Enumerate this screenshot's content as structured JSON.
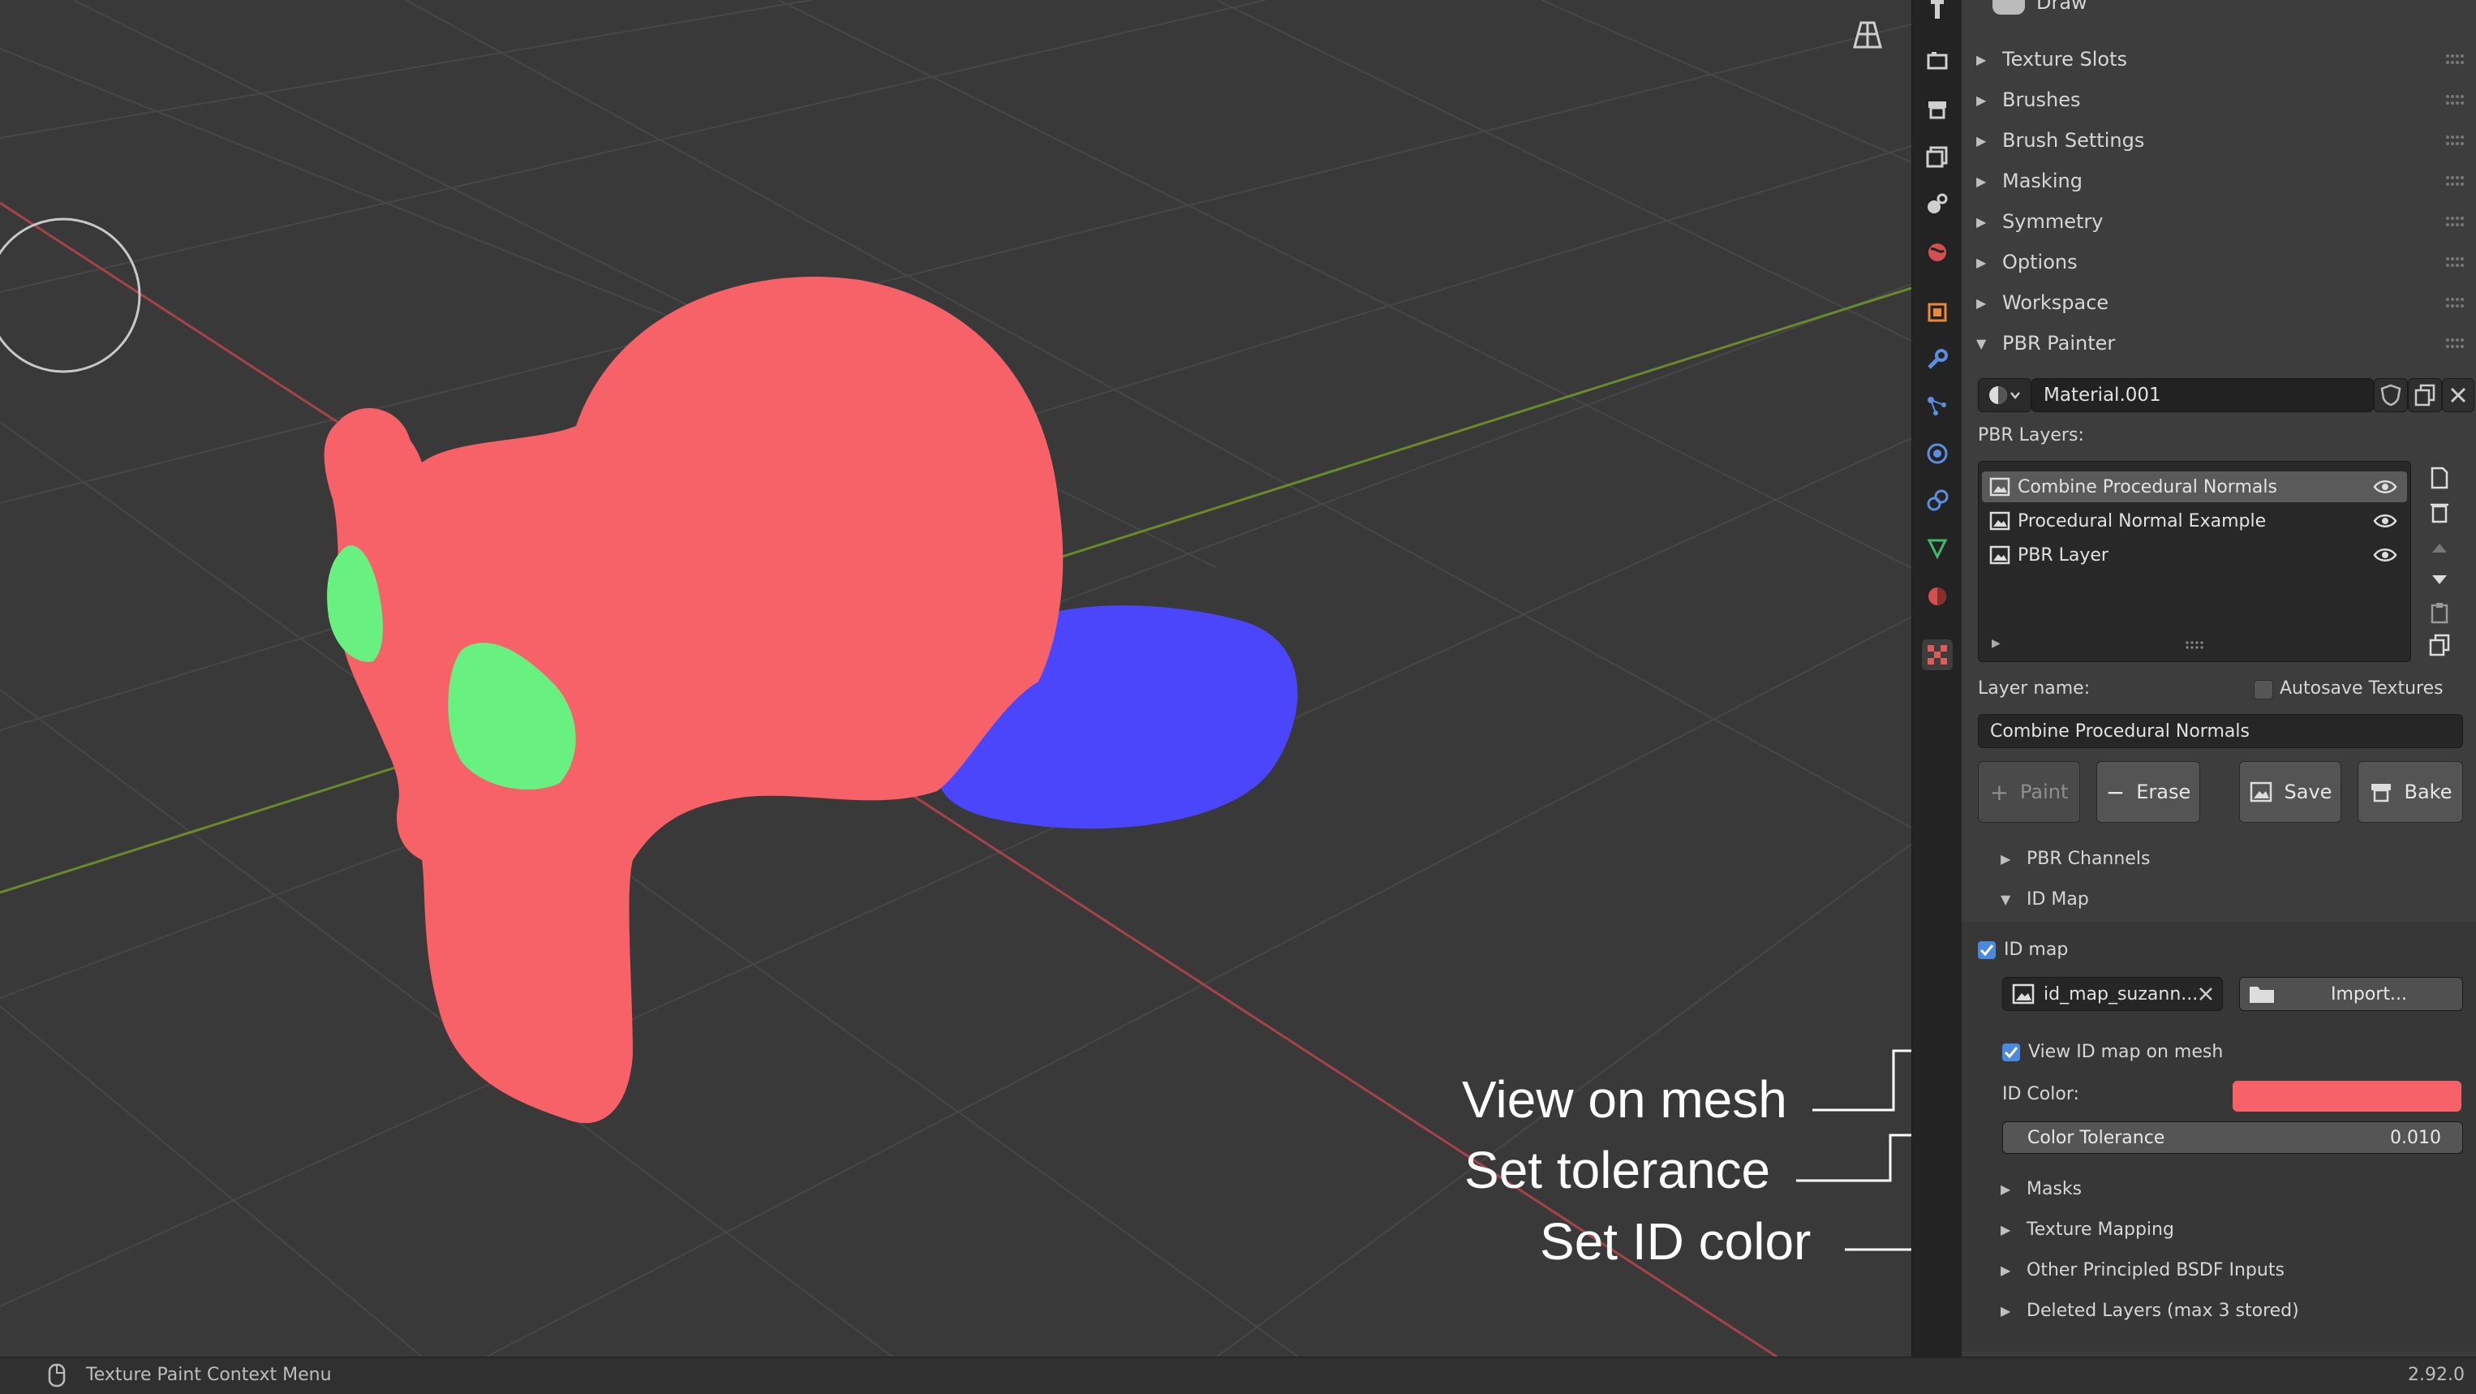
{
  "properties_tabs": [
    "tool-icon",
    "render-icon",
    "output-icon",
    "view-layer-icon",
    "scene-icon",
    "world-icon",
    "object-icon",
    "modifier-icon",
    "particles-icon",
    "physics-icon",
    "constraints-icon",
    "data-icon",
    "material-icon",
    "texture-icon"
  ],
  "panel": {
    "header_partial": "Draw",
    "sections": [
      "Texture Slots",
      "Brushes",
      "Brush Settings",
      "Masking",
      "Symmetry",
      "Options",
      "Workspace",
      "PBR Painter"
    ],
    "material": {
      "name": "Material.001"
    },
    "pbr_layers_label": "PBR Layers:",
    "layers": [
      {
        "name": "Combine Procedural Normals",
        "selected": true
      },
      {
        "name": "Procedural Normal Example",
        "selected": false
      },
      {
        "name": "PBR Layer",
        "selected": false
      }
    ],
    "layer_name_label": "Layer name:",
    "layer_name_value": "Combine Procedural Normals",
    "autosave_label": "Autosave Textures",
    "buttons": {
      "paint": "Paint",
      "erase": "Erase",
      "save": "Save",
      "bake": "Bake"
    },
    "subsections_top": [
      "PBR Channels",
      "ID Map"
    ],
    "id_map": {
      "checkbox_label": "ID map",
      "image_name": "id_map_suzann...",
      "import_label": "Import...",
      "view_on_mesh_label": "View ID map on mesh",
      "id_color_label": "ID Color:",
      "id_color": "#f76168",
      "tolerance_label": "Color Tolerance",
      "tolerance_value": "0.010"
    },
    "subsections_bottom": [
      "Masks",
      "Texture Mapping",
      "Other Principled BSDF Inputs",
      "Deleted Layers (max 3 stored)"
    ]
  },
  "callouts": {
    "view_on_mesh": "View on mesh",
    "set_tolerance": "Set tolerance",
    "set_id_color": "Set ID color"
  },
  "statusbar": {
    "context_menu": "Texture Paint Context Menu",
    "version": "2.92.0"
  },
  "colors": {
    "mesh_body": "#f76168",
    "mesh_eyes": "#68f080",
    "mesh_ear": "#4b46fb",
    "axis_x": "#a8424a",
    "axis_y": "#6a8a2a"
  }
}
